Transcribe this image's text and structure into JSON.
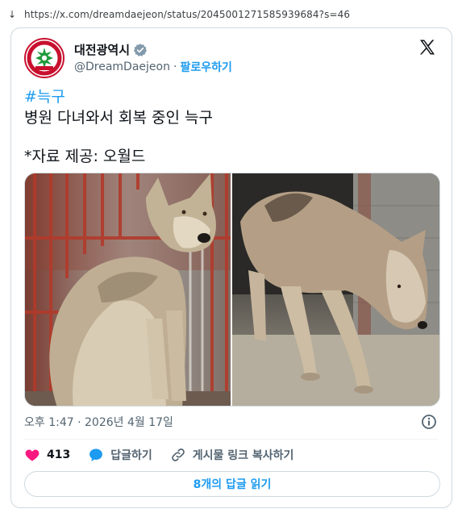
{
  "browser": {
    "back_arrow": "↓",
    "url": "https://x.com/dreamdaejeon/status/2045001271585939684?s=46"
  },
  "tweet": {
    "display_name": "대전광역시",
    "handle": "@DreamDaejeon",
    "separator": "·",
    "follow_label": "팔로우하기",
    "hashtag": "#늑구",
    "line1": "병원 다녀와서 회복 중인 늑구",
    "line2": "*자료 제공: 오월드",
    "timestamp": "오후 1:47 · 2026년 4월 17일",
    "like_count": "413",
    "reply_label": "답글하기",
    "copy_link_label": "게시물 링크 복사하기",
    "read_replies_label": "8개의 답글 읽기"
  },
  "icons": {
    "verified": "verified-badge-icon",
    "x_logo": "x-logo-icon",
    "info": "info-icon",
    "heart": "heart-icon",
    "reply": "reply-bubble-icon",
    "link": "link-icon"
  },
  "colors": {
    "accent": "#1d9bf0",
    "heart": "#f91880",
    "border": "#cfd9de",
    "secondary_text": "#536471"
  }
}
